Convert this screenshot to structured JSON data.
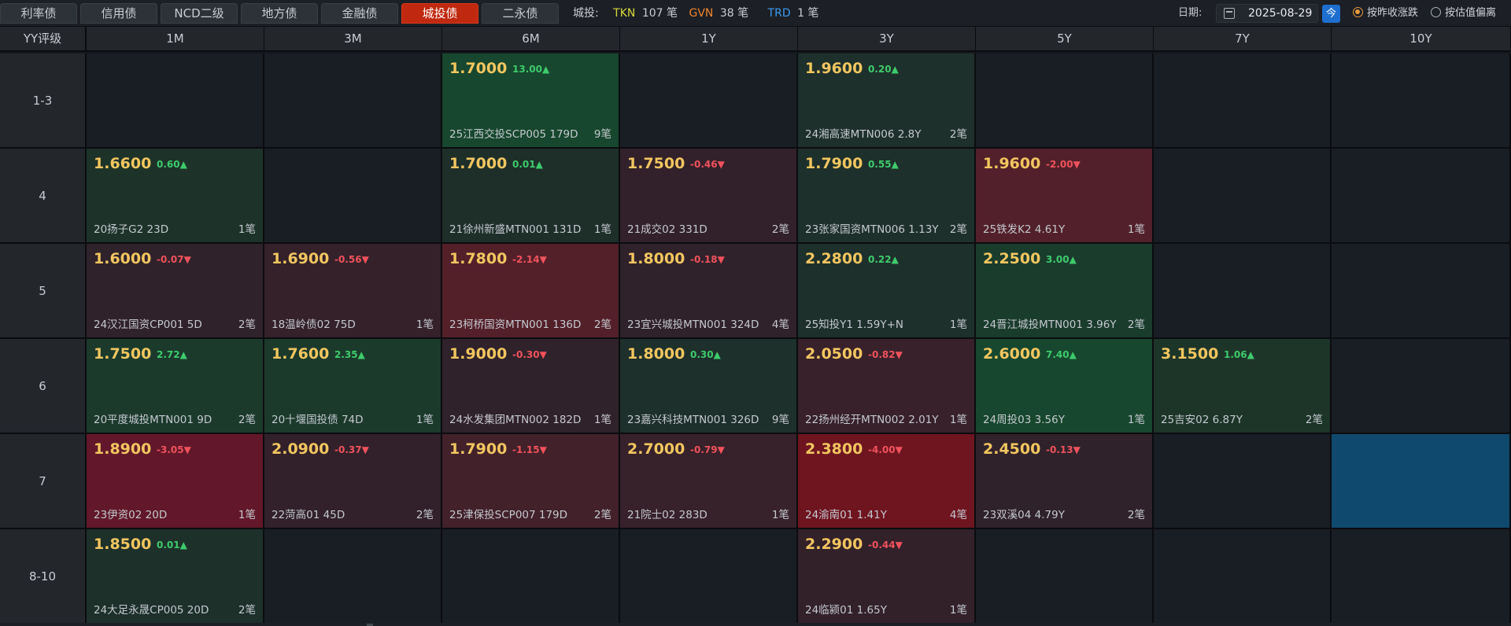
{
  "tabs": [
    {
      "label": "利率债",
      "active": false
    },
    {
      "label": "信用债",
      "active": false
    },
    {
      "label": "NCD二级",
      "active": false
    },
    {
      "label": "地方债",
      "active": false
    },
    {
      "label": "金融债",
      "active": false
    },
    {
      "label": "城投债",
      "active": true
    },
    {
      "label": "二永债",
      "active": false
    }
  ],
  "filter": {
    "label": "城投:",
    "items": [
      {
        "code": "TKN",
        "count": "107 笔",
        "color": "#d6d93a"
      },
      {
        "code": "GVN",
        "count": "38 笔",
        "color": "#f0862c"
      },
      {
        "code": "TRD",
        "count": "1 笔",
        "color": "#3a9bf0"
      }
    ]
  },
  "date": {
    "label": "日期:",
    "value": "2025-08-29",
    "today_label": "今"
  },
  "radios": [
    {
      "label": "按昨收涨跌",
      "checked": true
    },
    {
      "label": "按估值偏离",
      "checked": false
    }
  ],
  "corner_label": "YY评级",
  "columns": [
    "1M",
    "3M",
    "6M",
    "1Y",
    "3Y",
    "5Y",
    "7Y",
    "10Y"
  ],
  "rows": [
    "1-3",
    "4",
    "5",
    "6",
    "7",
    "8-10"
  ],
  "cells": [
    [
      null,
      null,
      {
        "yield": "1.7000",
        "change": "13.00▲",
        "dir": "up",
        "bond": "25江西交投SCP005 179D",
        "count": "9笔",
        "bg": "#17472e"
      },
      null,
      {
        "yield": "1.9600",
        "change": "0.20▲",
        "dir": "up",
        "bond": "24湘高速MTN006 2.8Y",
        "count": "2笔",
        "bg": "#1e302b"
      },
      null,
      null,
      null
    ],
    [
      {
        "yield": "1.6600",
        "change": "0.60▲",
        "dir": "up",
        "bond": "20扬子G2 23D",
        "count": "1笔",
        "bg": "#1d3329"
      },
      null,
      {
        "yield": "1.7000",
        "change": "0.01▲",
        "dir": "up",
        "bond": "21徐州新盛MTN001 131D",
        "count": "1笔",
        "bg": "#1e2f2a"
      },
      {
        "yield": "1.7500",
        "change": "-0.46▼",
        "dir": "dn",
        "bond": "21成交02 331D",
        "count": "2笔",
        "bg": "#32212a"
      },
      {
        "yield": "1.7900",
        "change": "0.55▲",
        "dir": "up",
        "bond": "23张家国资MTN006 1.13Y",
        "count": "2笔",
        "bg": "#1e302b"
      },
      {
        "yield": "1.9600",
        "change": "-2.00▼",
        "dir": "dn",
        "bond": "25铁发K2 4.61Y",
        "count": "1笔",
        "bg": "#52202a"
      },
      null,
      null
    ],
    [
      {
        "yield": "1.6000",
        "change": "-0.07▼",
        "dir": "dn",
        "bond": "24汉江国资CP001 5D",
        "count": "2笔",
        "bg": "#30222a"
      },
      {
        "yield": "1.6900",
        "change": "-0.56▼",
        "dir": "dn",
        "bond": "18温岭债02 75D",
        "count": "1笔",
        "bg": "#34212a"
      },
      {
        "yield": "1.7800",
        "change": "-2.14▼",
        "dir": "dn",
        "bond": "23柯桥国资MTN001 136D",
        "count": "2笔",
        "bg": "#53202a"
      },
      {
        "yield": "1.8000",
        "change": "-0.18▼",
        "dir": "dn",
        "bond": "23宜兴城投MTN001 324D",
        "count": "4笔",
        "bg": "#30222a"
      },
      {
        "yield": "2.2800",
        "change": "0.22▲",
        "dir": "up",
        "bond": "25知投Y1 1.59Y+N",
        "count": "1笔",
        "bg": "#1e302b"
      },
      {
        "yield": "2.2500",
        "change": "3.00▲",
        "dir": "up",
        "bond": "24晋江城投MTN001 3.96Y",
        "count": "2笔",
        "bg": "#1a3c2d"
      },
      null,
      null
    ],
    [
      {
        "yield": "1.7500",
        "change": "2.72▲",
        "dir": "up",
        "bond": "20平度城投MTN001 9D",
        "count": "2笔",
        "bg": "#1b3a2c"
      },
      {
        "yield": "1.7600",
        "change": "2.35▲",
        "dir": "up",
        "bond": "20十堰国投债 74D",
        "count": "1笔",
        "bg": "#1b3a2c"
      },
      {
        "yield": "1.9000",
        "change": "-0.30▼",
        "dir": "dn",
        "bond": "24水发集团MTN002 182D",
        "count": "1笔",
        "bg": "#30222a"
      },
      {
        "yield": "1.8000",
        "change": "0.30▲",
        "dir": "up",
        "bond": "23嘉兴科技MTN001 326D",
        "count": "9笔",
        "bg": "#1e302b"
      },
      {
        "yield": "2.0500",
        "change": "-0.82▼",
        "dir": "dn",
        "bond": "22扬州经开MTN002 2.01Y",
        "count": "1笔",
        "bg": "#38212a"
      },
      {
        "yield": "2.6000",
        "change": "7.40▲",
        "dir": "up",
        "bond": "24周投03 3.56Y",
        "count": "1笔",
        "bg": "#17472e"
      },
      {
        "yield": "3.1500",
        "change": "1.06▲",
        "dir": "up",
        "bond": "25吉安02 6.87Y",
        "count": "2笔",
        "bg": "#1d3529"
      },
      null
    ],
    [
      {
        "yield": "1.8900",
        "change": "-3.05▼",
        "dir": "dn",
        "bond": "23伊资02 20D",
        "count": "1笔",
        "bg": "#62182a"
      },
      {
        "yield": "2.0900",
        "change": "-0.37▼",
        "dir": "dn",
        "bond": "22菏高01 45D",
        "count": "2笔",
        "bg": "#32212a"
      },
      {
        "yield": "1.7900",
        "change": "-1.15▼",
        "dir": "dn",
        "bond": "25津保投SCP007 179D",
        "count": "2笔",
        "bg": "#42212a"
      },
      {
        "yield": "2.7000",
        "change": "-0.79▼",
        "dir": "dn",
        "bond": "21院士02 283D",
        "count": "1笔",
        "bg": "#37212a"
      },
      {
        "yield": "2.3800",
        "change": "-4.00▼",
        "dir": "dn",
        "bond": "24渝南01 1.41Y",
        "count": "4笔",
        "bg": "#6f1520"
      },
      {
        "yield": "2.4500",
        "change": "-0.13▼",
        "dir": "dn",
        "bond": "23双溪04 4.79Y",
        "count": "2笔",
        "bg": "#30222a"
      },
      null,
      {
        "empty_highlight": true,
        "bg": "#0f4a6e"
      }
    ],
    [
      {
        "yield": "1.8500",
        "change": "0.01▲",
        "dir": "up",
        "bond": "24大足永晟CP005 20D",
        "count": "2笔",
        "bg": "#1d302a"
      },
      null,
      null,
      null,
      {
        "yield": "2.2900",
        "change": "-0.44▼",
        "dir": "dn",
        "bond": "24临颍01 1.65Y",
        "count": "1笔",
        "bg": "#33212a"
      },
      null,
      null,
      null
    ]
  ]
}
